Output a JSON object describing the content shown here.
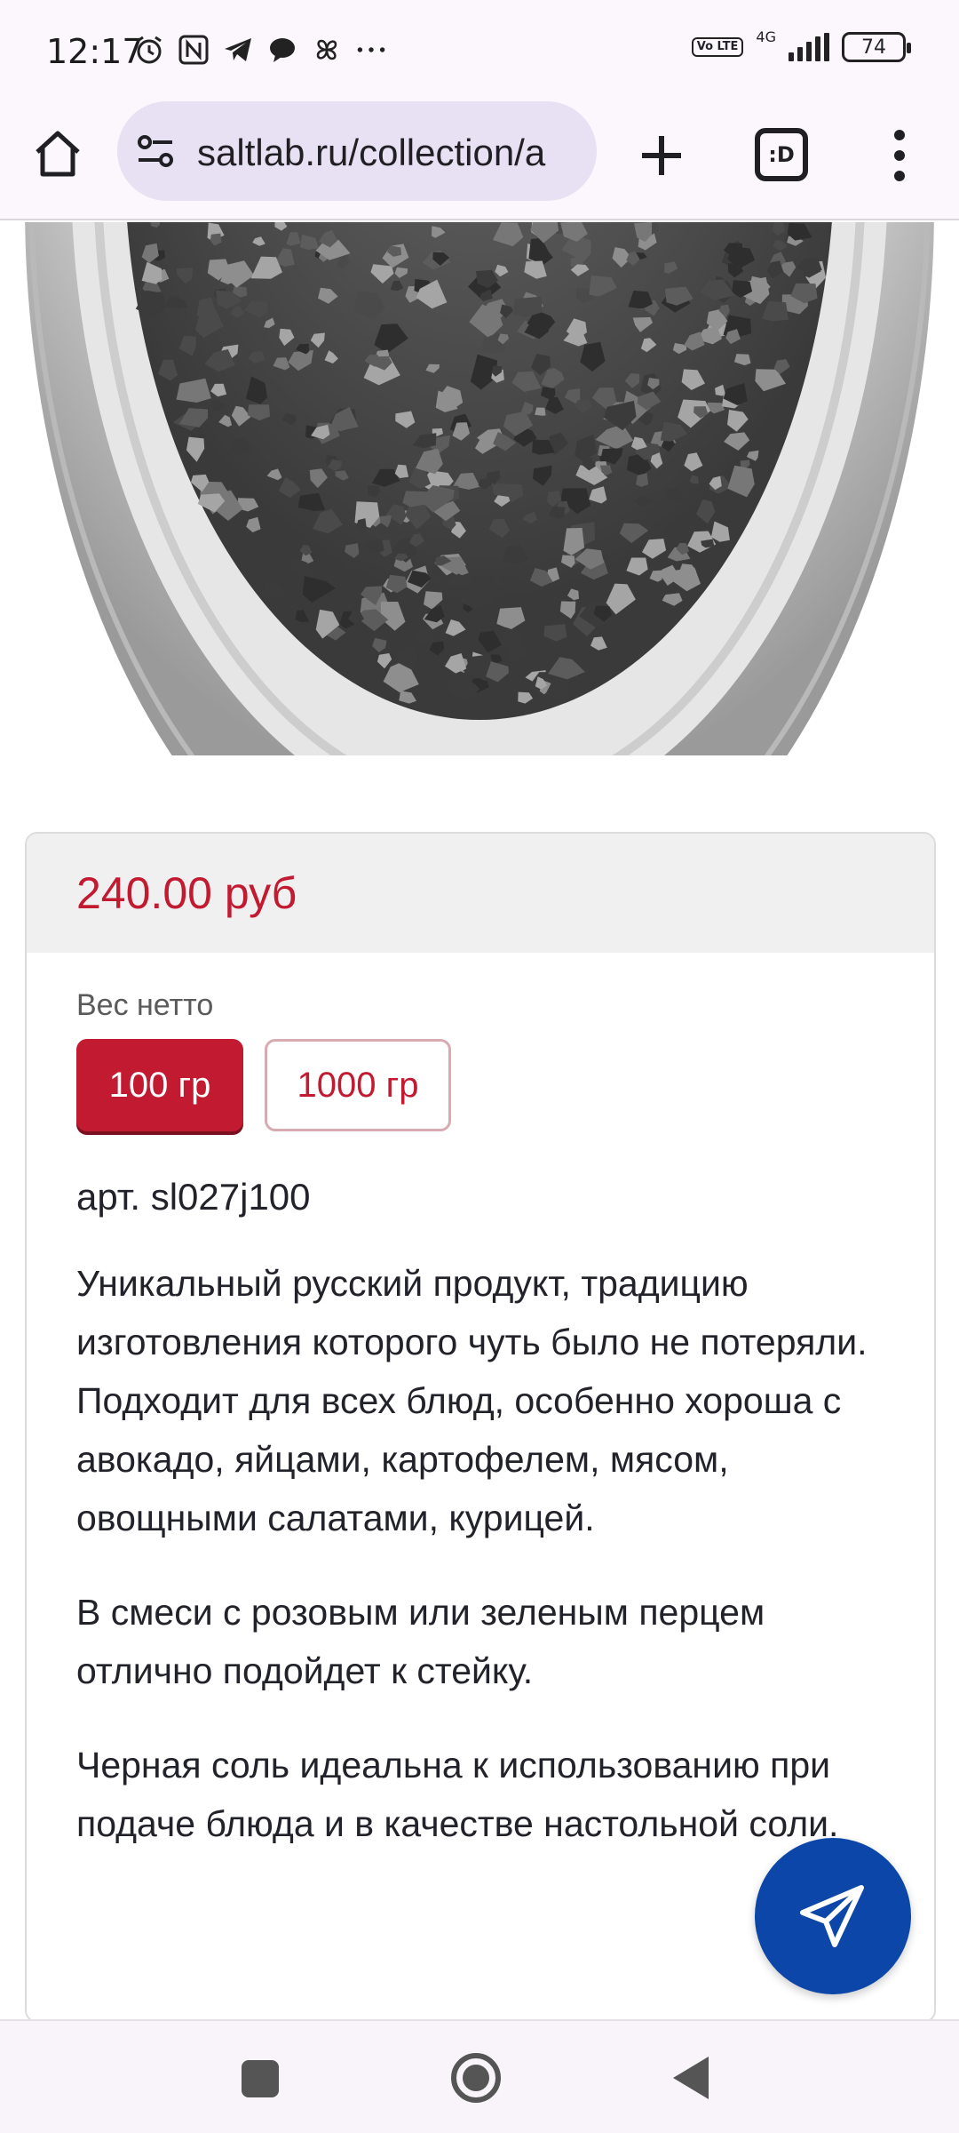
{
  "status_bar": {
    "time": "12:17",
    "left_icons": [
      "alarm-icon",
      "nfc-icon",
      "telegram-icon",
      "chat-bubble-icon",
      "pinwheel-icon",
      "more-dots-icon"
    ],
    "network": "4G",
    "volte": "Vo LTE",
    "battery": "74"
  },
  "browser": {
    "url": "saltlab.ru/collection/a",
    "tabs_label": ":D"
  },
  "product_image": {
    "icon": "black-salt-photo"
  },
  "product": {
    "price": "240.00 руб",
    "weight_label": "Вес нетто",
    "weight_options": [
      {
        "label": "100 гр",
        "selected": true
      },
      {
        "label": "1000 гр",
        "selected": false
      }
    ],
    "sku": "арт. sl027j100",
    "description": [
      "Уникальный русский продукт, традицию изготовления которого чуть было не потеряли. Подходит для всех блюд, особенно хороша с авокадо, яйцами, картофелем, мясом, овощными салатами, курицей.",
      "В смеси с розовым или зеленым перцем отлично подойдет к стейку.",
      "Черная соль идеальна к использованию при подаче блюда и в качестве настольной соли."
    ]
  },
  "colors": {
    "accent": "#c21a30",
    "fab": "#0b46a8",
    "price_band": "#f0f0f0"
  },
  "fab": {
    "icon": "paper-plane-icon"
  },
  "nav_bar": {
    "icons": [
      "recents-icon",
      "home-icon",
      "back-icon"
    ]
  }
}
